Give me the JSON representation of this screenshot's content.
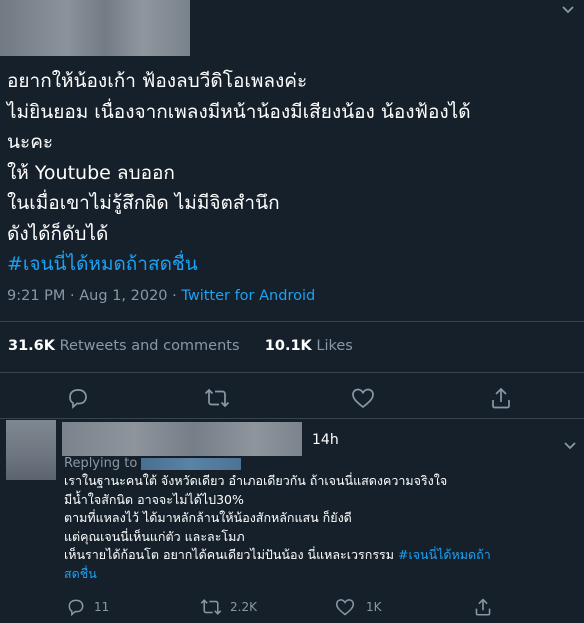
{
  "tweet": {
    "lines": [
      "อยากให้น้องเก้า ฟ้องลบวีดิโอเพลงค่ะ",
      "ไม่ยินยอม เนื่องจากเพลงมีหน้าน้องมีเสียงน้อง  น้องฟ้องได้",
      "นะคะ",
      "ให้ Youtube ลบออก",
      "ในเมื่อเขาไม่รู้สึกผิด ไม่มีจิตสำนึก",
      "ดังได้ก็ดับได้"
    ],
    "hashtag": "#เจนนี่ได้หมดถ้าสดชื่น",
    "time": "9:21 PM",
    "separator": "·",
    "date": "Aug 1, 2020",
    "source": "Twitter for Android",
    "retweets_count": "31.6K",
    "retweets_label": "Retweets and comments",
    "likes_count": "10.1K",
    "likes_label": "Likes"
  },
  "reply": {
    "time": "14h",
    "replying_to": "Replying to",
    "lines": [
      "เราในฐานะคนใต้ จังหวัดเดียว อำเภอเดียวกัน ถ้าเจนนี่แสดงความจริงใจ",
      "มีน้ำใจสักนิด อาจจะไม่ได้ไป30%",
      "ตามที่แหลงไว้ ได้มาหลักล้านให้น้องสักหลักแสน ก็ยังดี",
      "แต่คุณเจนนี่เห็นแก่ตัว และละโมภ"
    ],
    "last_line": "เห็นรายได้ก้อนโต อยากได้คนเดียวไม่ปันน้อง  นี่แหละเวรกรรม ",
    "hashtag_part1": "#เจนนี่ได้หมดถ้า",
    "hashtag_part2": "สดชื่น",
    "reply_count": "11",
    "retweet_count": "2.2K",
    "like_count": "1K"
  },
  "colors": {
    "background": "#15202b",
    "accent": "#1da1f2",
    "muted": "#8899a6",
    "divider": "#38444d"
  },
  "icons": [
    "chevron-down-icon",
    "reply-icon",
    "retweet-icon",
    "like-icon",
    "share-icon"
  ]
}
